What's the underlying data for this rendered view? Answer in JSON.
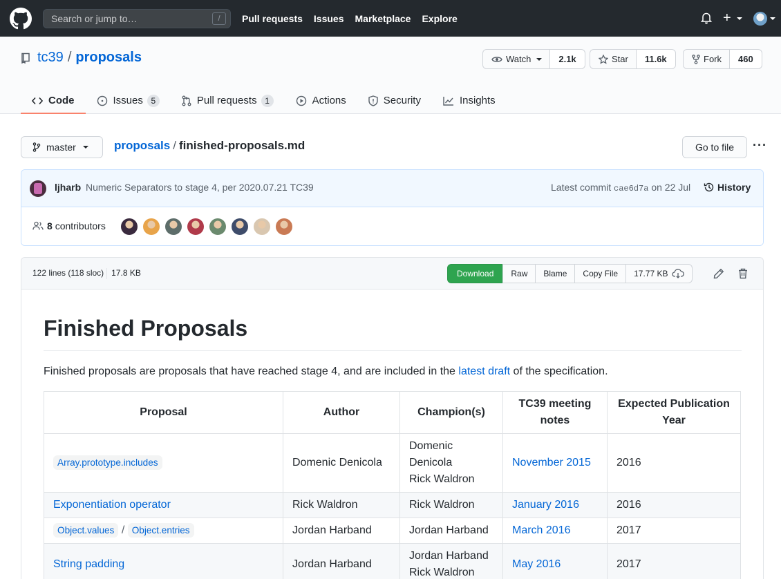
{
  "header": {
    "search_placeholder": "Search or jump to…",
    "search_key": "/",
    "nav": [
      "Pull requests",
      "Issues",
      "Marketplace",
      "Explore"
    ],
    "plus": "+"
  },
  "repo": {
    "owner": "tc39",
    "separator": "/",
    "name": "proposals",
    "watch": {
      "label": "Watch",
      "count": "2.1k"
    },
    "star": {
      "label": "Star",
      "count": "11.6k"
    },
    "fork": {
      "label": "Fork",
      "count": "460"
    },
    "tabs": [
      {
        "label": "Code",
        "icon": "code-icon"
      },
      {
        "label": "Issues",
        "icon": "issue-icon",
        "count": "5"
      },
      {
        "label": "Pull requests",
        "icon": "pull-request-icon",
        "count": "1"
      },
      {
        "label": "Actions",
        "icon": "play-icon"
      },
      {
        "label": "Security",
        "icon": "shield-icon"
      },
      {
        "label": "Insights",
        "icon": "graph-icon"
      }
    ]
  },
  "filenav": {
    "branch": "master",
    "root": "proposals",
    "slash": "/",
    "file": "finished-proposals.md",
    "goto": "Go to file",
    "more": "···"
  },
  "commit": {
    "author": "ljharb",
    "message": "Numeric Separators to stage 4, per 2020.07.21 TC39",
    "latest_prefix": "Latest commit",
    "sha": "cae6d7a",
    "date": "on 22 Jul",
    "history": "History",
    "contributors_count": "8",
    "contributors_label": "contributors",
    "avatar_colors": [
      "#3a2a3e",
      "#e8a44a",
      "#5d6d6a",
      "#b03a4a",
      "#6b8a6e",
      "#3e4c6a",
      "#d9c7b0",
      "#c97a54"
    ]
  },
  "file": {
    "lines": "122 lines (118 sloc)",
    "size": "17.8 KB",
    "buttons": {
      "download": "Download",
      "raw": "Raw",
      "blame": "Blame",
      "copy": "Copy File",
      "filesize": "17.77 KB"
    }
  },
  "markdown": {
    "title": "Finished Proposals",
    "intro_before": "Finished proposals are proposals that have reached stage 4, and are included in the ",
    "intro_link": "latest draft",
    "intro_after": " of the specification.",
    "columns": [
      "Proposal",
      "Author",
      "Champion(s)",
      "TC39 meeting notes",
      "Expected Publication Year"
    ],
    "rows": [
      {
        "proposal": "Array.prototype.includes",
        "proposal_code": true,
        "author": "Domenic Denicola",
        "champions": [
          "Domenic Denicola",
          "Rick Waldron"
        ],
        "notes": "November 2015",
        "year": "2016"
      },
      {
        "proposal": "Exponentiation operator",
        "proposal_code": false,
        "author": "Rick Waldron",
        "champions": [
          "Rick Waldron"
        ],
        "notes": "January 2016",
        "year": "2016"
      },
      {
        "proposal": "Object.values",
        "proposal2": "Object.entries",
        "proposal_code": true,
        "author": "Jordan Harband",
        "champions": [
          "Jordan Harband"
        ],
        "notes": "March 2016",
        "year": "2017"
      },
      {
        "proposal": "String padding",
        "proposal_code": false,
        "author": "Jordan Harband",
        "champions": [
          "Jordan Harband",
          "Rick Waldron"
        ],
        "notes": "May 2016",
        "year": "2017"
      }
    ]
  }
}
